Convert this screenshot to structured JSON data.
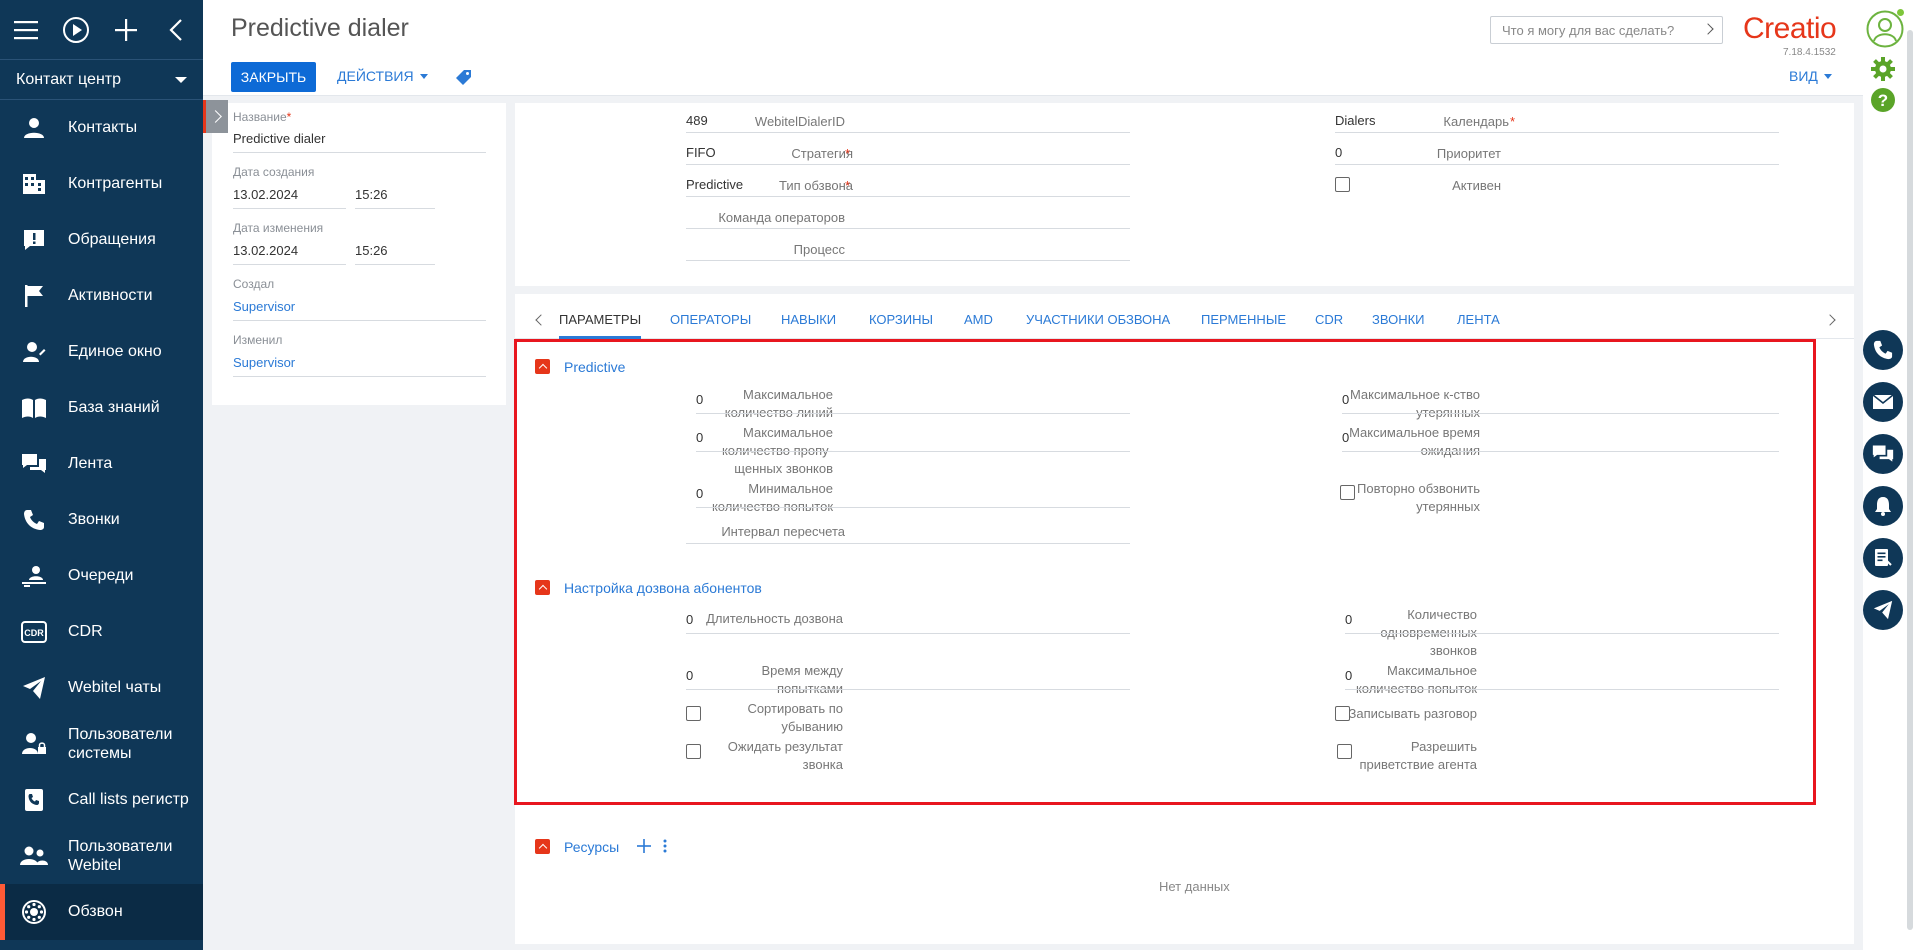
{
  "sidebar": {
    "workspace": "Контакт центр",
    "items": [
      {
        "label": "Контакты",
        "icon": "person-icon"
      },
      {
        "label": "Контрагенты",
        "icon": "building-icon"
      },
      {
        "label": "Обращения",
        "icon": "exclamation-card-icon"
      },
      {
        "label": "Активности",
        "icon": "flag-icon"
      },
      {
        "label": "Единое окно",
        "icon": "person-pencil-icon"
      },
      {
        "label": "База знаний",
        "icon": "book-icon"
      },
      {
        "label": "Лента",
        "icon": "chat-bubbles-icon"
      },
      {
        "label": "Звонки",
        "icon": "phone-icon"
      },
      {
        "label": "Очереди",
        "icon": "queue-icon"
      },
      {
        "label": "CDR",
        "icon": "cdr-icon"
      },
      {
        "label": "Webitel чаты",
        "icon": "telegram-icon"
      },
      {
        "label": "Пользователи системы",
        "icon": "user-lock-icon"
      },
      {
        "label": "Call lists регистр",
        "icon": "phone-book-icon"
      },
      {
        "label": "Пользователи Webitel",
        "icon": "users-icon"
      },
      {
        "label": "Обзвон",
        "icon": "dialer-icon"
      }
    ]
  },
  "header": {
    "title": "Predictive dialer",
    "close_label": "ЗАКРЫТЬ",
    "actions_label": "ДЕЙСТВИЯ",
    "search_placeholder": "Что я могу для вас сделать?",
    "logo": "Creatio",
    "version": "7.18.4.1532",
    "view_label": "ВИД"
  },
  "left_panel": {
    "name_label": "Название",
    "name_value": "Predictive dialer",
    "created_label": "Дата создания",
    "created_date": "13.02.2024",
    "created_time": "15:26",
    "modified_label": "Дата изменения",
    "modified_date": "13.02.2024",
    "modified_time": "15:26",
    "created_by_label": "Создал",
    "created_by": "Supervisor",
    "modified_by_label": "Изменил",
    "modified_by": "Supervisor"
  },
  "top_form": {
    "dialer_id_label": "WebitelDialerID",
    "dialer_id": "489",
    "strategy_label": "Стратегия",
    "strategy": "FIFO",
    "type_label": "Тип обзвона",
    "type": "Predictive",
    "team_label": "Команда операторов",
    "team": "",
    "process_label": "Процесс",
    "process": "",
    "calendar_label": "Календарь",
    "calendar": "Dialers",
    "priority_label": "Приоритет",
    "priority": "0",
    "active_label": "Активен",
    "active": false
  },
  "tabs": [
    "ПАРАМЕТРЫ",
    "ОПЕРАТОРЫ",
    "НАВЫКИ",
    "КОРЗИНЫ",
    "AMD",
    "УЧАСТНИКИ ОБЗВОНА",
    "ПЕРМЕННЫЕ",
    "CDR",
    "ЗВОНКИ",
    "ЛЕНТА"
  ],
  "predictive": {
    "title": "Predictive",
    "max_lines_label_1": "Максимальное",
    "max_lines_label_2": "количество линий",
    "max_lines": "0",
    "max_missed_label_1": "Максимальное",
    "max_missed_label_2": "количество пропу-",
    "max_missed_label_3": "щенных звонков",
    "max_missed": "0",
    "min_attempts_label_1": "Минимальное",
    "min_attempts_label_2": "количество попыток",
    "min_attempts": "0",
    "recalc_label": "Интервал пересчета",
    "recalc": "",
    "max_lost_label_1": "Максимальное к-ство",
    "max_lost_label_2": "утерянных",
    "max_lost": "0",
    "max_wait_label_1": "Максимальное время",
    "max_wait_label_2": "ожидания",
    "max_wait": "0",
    "redial_lost_label_1": "Повторно обзвонить",
    "redial_lost_label_2": "утерянных"
  },
  "dial_settings": {
    "title": "Настройка дозвона абонентов",
    "duration_label": "Длительность дозвона",
    "duration": "0",
    "interval_label_1": "Время между",
    "interval_label_2": "попытками",
    "interval": "0",
    "sort_label_1": "Сортировать по",
    "sort_label_2": "убыванию",
    "wait_result_label_1": "Ожидать результат",
    "wait_result_label_2": "звонка",
    "concurrent_label_1": "Количество",
    "concurrent_label_2": "одновременных",
    "concurrent_label_3": "звонков",
    "concurrent": "0",
    "max_attempts_label_1": "Максимальное",
    "max_attempts_label_2": "количество попыток",
    "max_attempts": "0",
    "record_label": "Записывать разговор",
    "greeting_label_1": "Разрешить",
    "greeting_label_2": "приветствие агента"
  },
  "resources": {
    "title": "Ресурсы",
    "empty": "Нет данных"
  },
  "colors": {
    "sidebar_bg": "#0f3757",
    "accent": "#0d6ad6",
    "brand_red": "#e6361a",
    "highlight_box": "#e8161f"
  }
}
